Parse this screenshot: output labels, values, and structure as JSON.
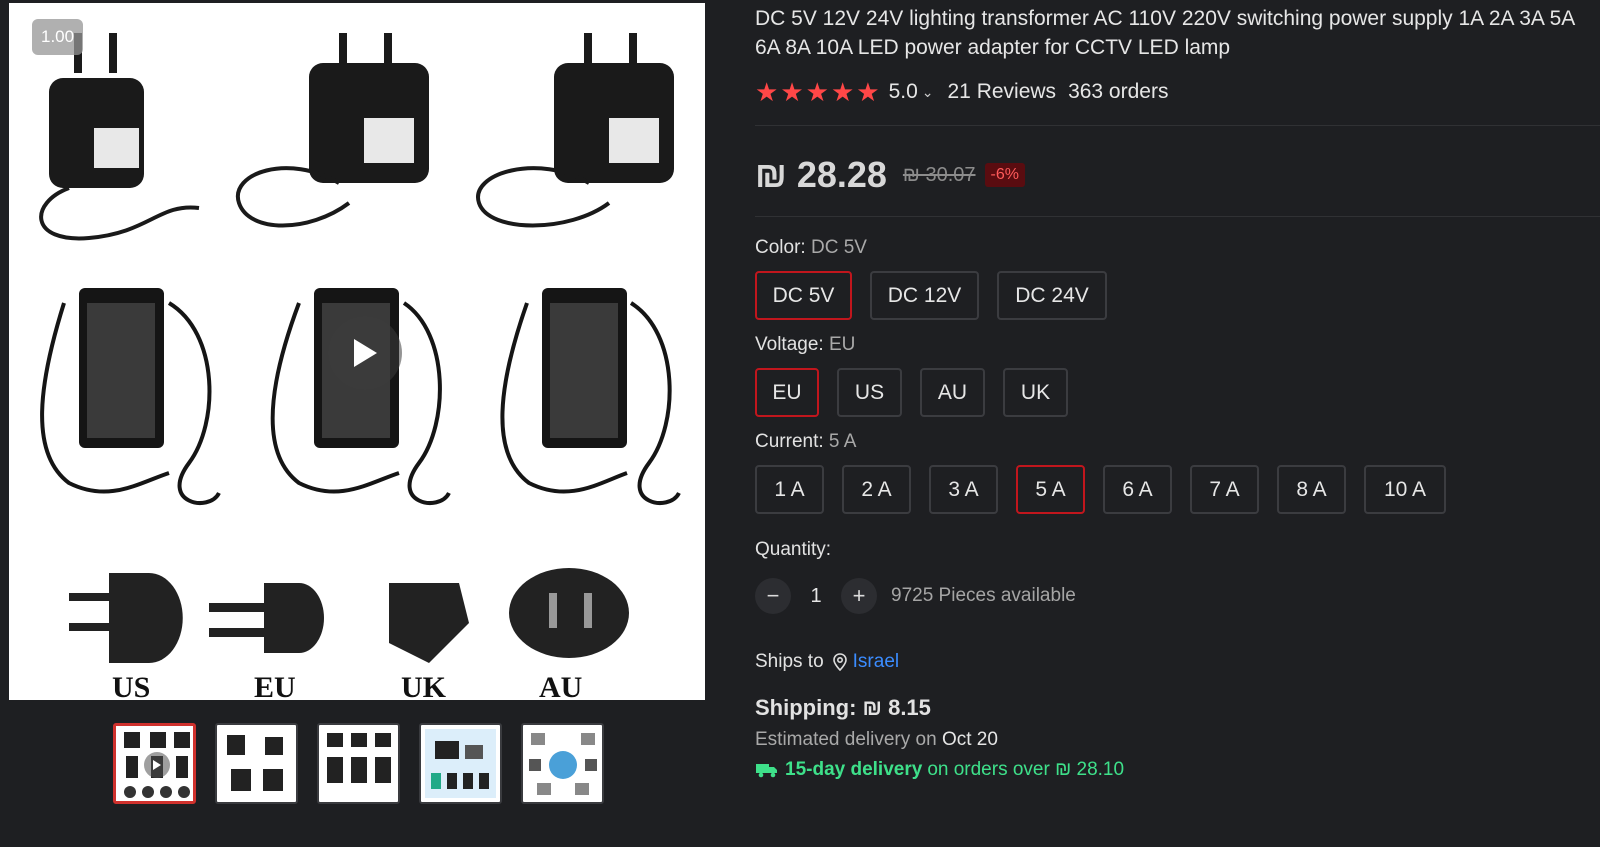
{
  "gallery": {
    "zoom_label": "1.00",
    "plug_labels": [
      "US",
      "EU",
      "UK",
      "AU"
    ],
    "thumbnail_count": 5
  },
  "product": {
    "title": "DC 5V 12V 24V lighting transformer AC 110V 220V switching power supply 1A 2A 3A 5A 6A 8A 10A LED power adapter for CCTV LED lamp",
    "rating": "5.0",
    "reviews": "21 Reviews",
    "orders": "363 orders",
    "price": "₪ 28.28",
    "old_price": "₪ 30.07",
    "discount": "-6%"
  },
  "color": {
    "label": "Color:",
    "selected": "DC 5V",
    "options": [
      "DC 5V",
      "DC 12V",
      "DC 24V"
    ]
  },
  "voltage": {
    "label": "Voltage:",
    "selected": "EU",
    "options": [
      "EU",
      "US",
      "AU",
      "UK"
    ]
  },
  "current": {
    "label": "Current:",
    "selected": "5 A",
    "options": [
      "1 A",
      "2 A",
      "3 A",
      "5 A",
      "6 A",
      "7 A",
      "8 A",
      "10 A"
    ]
  },
  "quantity": {
    "label": "Quantity:",
    "value": "1",
    "minus": "−",
    "plus": "+",
    "available": "9725 Pieces available"
  },
  "shipping": {
    "ships_to_label": "Ships to",
    "country": "Israel",
    "cost_label": "Shipping: ₪ 8.15",
    "estimated_prefix": "Estimated delivery on",
    "estimated_date": "Oct 20",
    "fast_delivery": "15-day delivery",
    "fast_delivery_suffix": "on orders over ₪ 28.10"
  },
  "colors": {
    "accent_red": "#c1161d",
    "star": "#ff4747",
    "link_blue": "#3b8cff",
    "delivery_green": "#3ee08a"
  }
}
